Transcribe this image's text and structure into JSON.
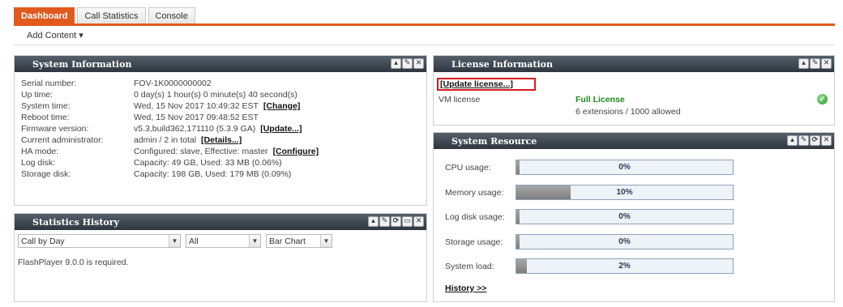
{
  "tabs": [
    {
      "label": "Dashboard"
    },
    {
      "label": "Call Statistics"
    },
    {
      "label": "Console"
    }
  ],
  "toolbar": {
    "add_content": "Add Content ▾"
  },
  "system_info": {
    "title": "System Information",
    "rows": [
      {
        "label": "Serial number:",
        "value": "FOV-1K0000000002",
        "link": ""
      },
      {
        "label": "Up time:",
        "value": "0 day(s) 1 hour(s) 0 minute(s) 40 second(s)",
        "link": ""
      },
      {
        "label": "System time:",
        "value": "Wed, 15 Nov 2017 10:49:32 EST",
        "link": "[Change]"
      },
      {
        "label": "Reboot time:",
        "value": "Wed, 15 Nov 2017 09:48:52 EST",
        "link": ""
      },
      {
        "label": "Firmware version:",
        "value": "v5.3,build362,171110 (5.3.9 GA)",
        "link": "[Update...]"
      },
      {
        "label": "Current administrator:",
        "value": "admin / 2 in total",
        "link": "[Details...]"
      },
      {
        "label": "HA mode:",
        "value": "Configured: slave, Effective: master",
        "link": "[Configure]"
      },
      {
        "label": "Log disk:",
        "value": "Capacity: 49 GB, Used: 33 MB (0.06%)",
        "link": ""
      },
      {
        "label": "Storage disk:",
        "value": "Capacity: 198 GB, Used: 179 MB (0.09%)",
        "link": ""
      }
    ]
  },
  "stats_history": {
    "title": "Statistics History",
    "select_period": "Call by Day",
    "select_filter": "All",
    "select_chart": "Bar Chart",
    "message": "FlashPlayer 9.0.0 is required."
  },
  "license": {
    "title": "License Information",
    "update_link": "[Update license...]",
    "vm_label": "VM license",
    "status": "Full License",
    "detail": "6 extensions / 1000 allowed",
    "status_color": "#1c8a1c"
  },
  "resource": {
    "title": "System Resource",
    "items": [
      {
        "label": "CPU usage:",
        "value": "0%",
        "fraction": 0.0
      },
      {
        "label": "Memory usage:",
        "value": "10%",
        "fraction": 0.1
      },
      {
        "label": "Log disk usage:",
        "value": "0%",
        "fraction": 0.0
      },
      {
        "label": "Storage usage:",
        "value": "0%",
        "fraction": 0.0
      },
      {
        "label": "System load:",
        "value": "2%",
        "fraction": 0.02
      }
    ],
    "history_link": "History >>"
  }
}
